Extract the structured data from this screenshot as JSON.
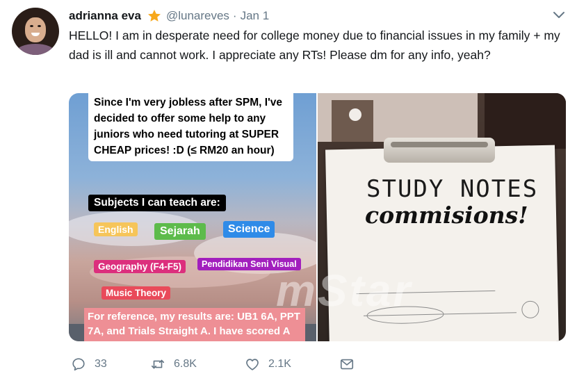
{
  "tweet": {
    "author_name": "adrianna eva",
    "handle": "@lunareves",
    "separator": "·",
    "date": "Jan 1",
    "text": "HELLO! I am in desperate need for college money due to financial issues in my family + my dad is ill and cannot work. I appreciate any RTs! Please dm for any info, yeah?",
    "verified_icon": "star-icon",
    "menu_icon": "chevron-down-icon"
  },
  "media": {
    "left": {
      "intro": "Since I'm very jobless after SPM, I've decided to offer some help to any juniors who need tutoring at SUPER CHEAP prices! :D (≤ RM20 an hour)",
      "subjects_heading": "Subjects I can teach are:",
      "subjects": [
        "English",
        "Sejarah",
        "Science",
        "Geography (F4-F5)",
        "Pendidikan Seni Visual",
        "Music Theory"
      ],
      "results": "For reference, my results are: UB1 6A, PPT 7A, and Trials Straight A. I have scored A"
    },
    "right": {
      "title": "STUDY NOTES",
      "subtitle": "commisions!"
    },
    "watermark": "mStar"
  },
  "actions": {
    "replies": "33",
    "retweets": "6.8K",
    "likes": "2.1K"
  }
}
